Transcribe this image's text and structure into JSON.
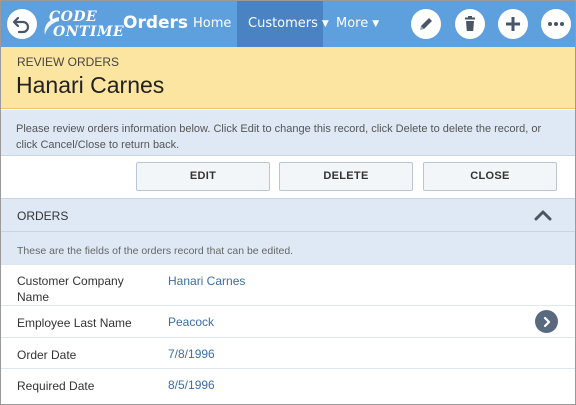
{
  "topbar": {
    "logo_line1": "CODE",
    "logo_line2": "ONTIME",
    "app_title": "Orders",
    "nav": [
      {
        "label": "Home"
      },
      {
        "label": "Customers"
      },
      {
        "label": "More"
      }
    ],
    "accent_color": "#5e9fdd",
    "active_nav_color": "#4983c4",
    "icons": [
      "back-arrow-icon",
      "pencil-icon",
      "trash-icon",
      "plus-icon",
      "ellipsis-icon"
    ]
  },
  "header": {
    "label": "REVIEW ORDERS",
    "title": "Hanari Carnes",
    "background": "#fce5a0"
  },
  "description": "Please review orders information below. Click Edit to change this record, click Delete to delete the record, or click Cancel/Close to return back.",
  "actions": {
    "edit": "EDIT",
    "delete": "DELETE",
    "close": "CLOSE"
  },
  "section": {
    "title": "ORDERS",
    "description": "These are the fields of the orders record that can be edited."
  },
  "fields": [
    {
      "label": "Customer Company Name",
      "value": "Hanari Carnes"
    },
    {
      "label": "Employee Last Name",
      "value": "Peacock"
    },
    {
      "label": "Order Date",
      "value": "7/8/1996"
    },
    {
      "label": "Required Date",
      "value": "8/5/1996"
    }
  ]
}
